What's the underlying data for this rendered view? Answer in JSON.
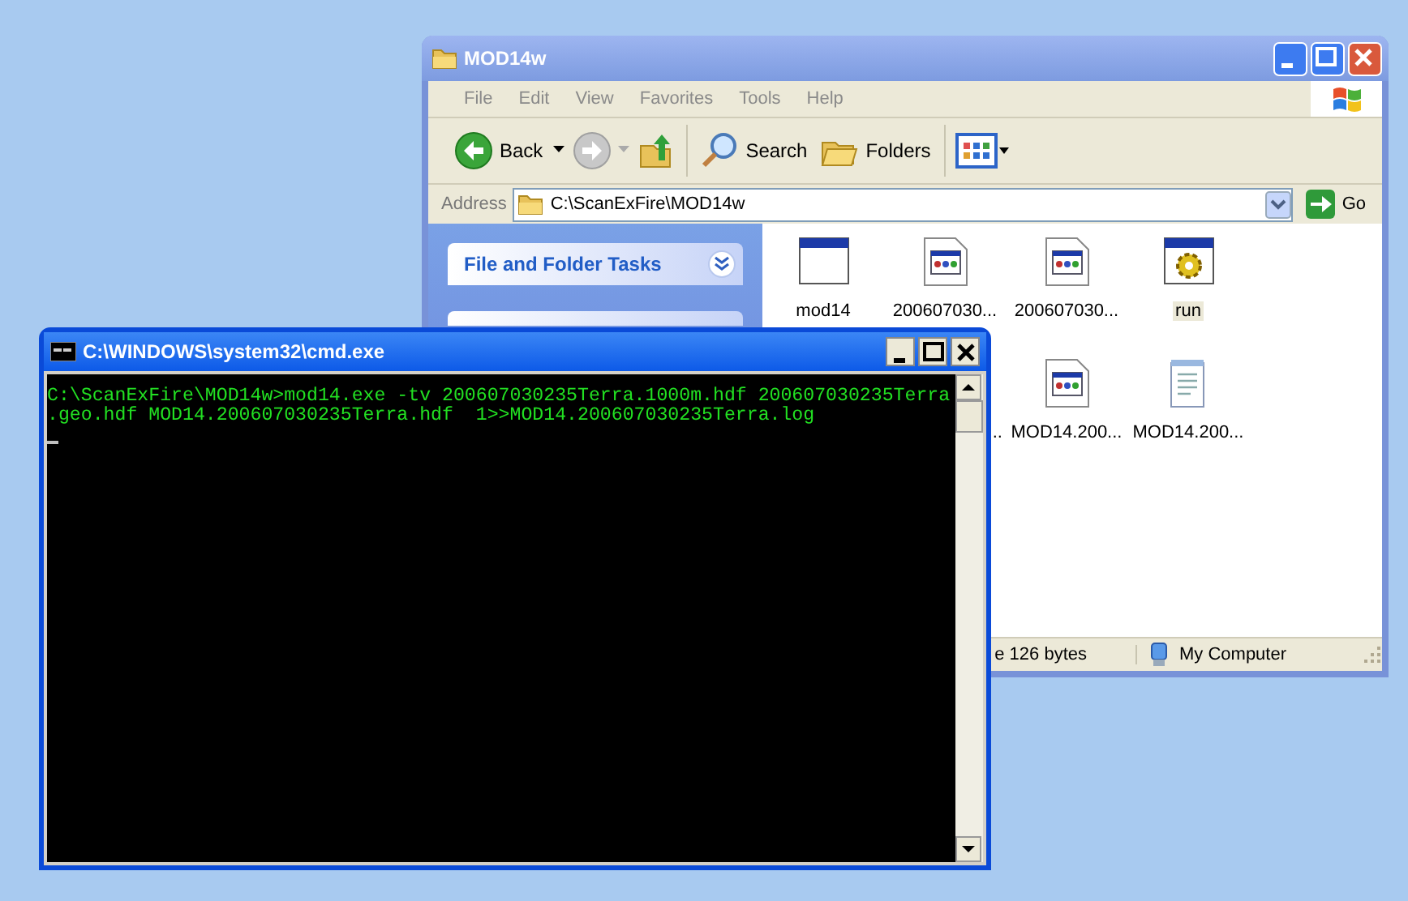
{
  "explorer": {
    "title": "MOD14w",
    "menu": [
      "File",
      "Edit",
      "View",
      "Favorites",
      "Tools",
      "Help"
    ],
    "toolbar": {
      "back": "Back",
      "search": "Search",
      "folders": "Folders"
    },
    "address": {
      "label": "Address",
      "value": "C:\\ScanExFire\\MOD14w",
      "go": "Go"
    },
    "tasks_panel": {
      "title": "File and Folder Tasks"
    },
    "files": [
      {
        "label": "mod14",
        "kind": "window",
        "selected": false
      },
      {
        "label": "200607030...",
        "kind": "doc",
        "selected": false
      },
      {
        "label": "200607030...",
        "kind": "doc",
        "selected": false
      },
      {
        "label": "run",
        "kind": "gear",
        "selected": true
      },
      {
        "label": "..",
        "kind": "partial",
        "selected": false
      },
      {
        "label": "MOD14.200...",
        "kind": "doc",
        "selected": false
      },
      {
        "label": "MOD14.200...",
        "kind": "notepad",
        "selected": false
      }
    ],
    "status_bar": {
      "size": "e 126 bytes",
      "zone": "My Computer"
    }
  },
  "cmd": {
    "title": "C:\\WINDOWS\\system32\\cmd.exe",
    "lines": [
      "C:\\ScanExFire\\MOD14w>mod14.exe -tv 200607030235Terra.1000m.hdf 200607030235Terra",
      ".geo.hdf MOD14.200607030235Terra.hdf  1>>MOD14.200607030235Terra.log"
    ]
  }
}
